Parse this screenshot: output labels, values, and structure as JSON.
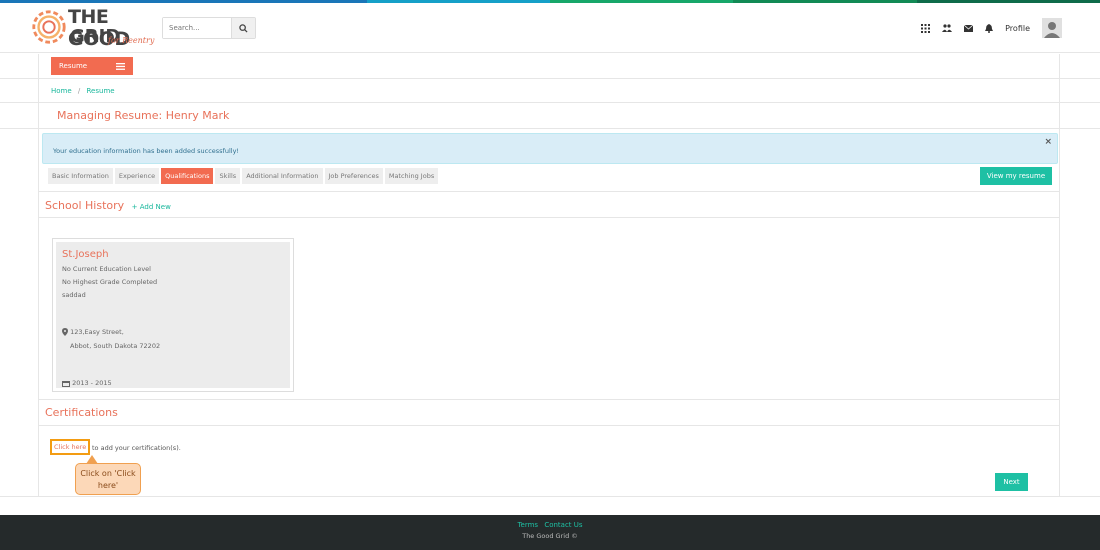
{
  "brand": {
    "word1": "THE GOOD",
    "word2": "GRID",
    "tagline": "for Reentry",
    "stripe_colors": [
      "#1a76b8",
      "#1a76b8",
      "#16a0c8",
      "#17a76a",
      "#128a55",
      "#0f6b4a"
    ]
  },
  "search": {
    "placeholder": "Search...",
    "icon": "search-icon"
  },
  "nav": {
    "icons": [
      "apps-grid-icon",
      "users-icon",
      "envelope-icon",
      "bell-icon"
    ],
    "profile_label": "Profile",
    "avatar_icon": "user-avatar-icon"
  },
  "menu": {
    "resume_label": "Resume",
    "menu_icon": "hamburger-icon"
  },
  "breadcrumb": {
    "home": "Home",
    "separator": "/",
    "current": "Resume"
  },
  "page_title": "Managing Resume: Henry Mark",
  "alert": {
    "message": "Your education information has been added successfully!",
    "close": "×"
  },
  "tabs": [
    {
      "label": "Basic Information",
      "active": false
    },
    {
      "label": "Experience",
      "active": false
    },
    {
      "label": "Qualifications",
      "active": true
    },
    {
      "label": "Skills",
      "active": false
    },
    {
      "label": "Additional Information",
      "active": false
    },
    {
      "label": "Job Preferences",
      "active": false
    },
    {
      "label": "Matching Jobs",
      "active": false
    }
  ],
  "view_resume_label": "View my resume",
  "school_history": {
    "title": "School History",
    "add_new": "+ Add New",
    "card": {
      "school": "St.Joseph",
      "education_level": "No Current Education Level",
      "highest_grade": "No Highest Grade Completed",
      "note": "saddad",
      "address_line1": "123,Easy Street,",
      "address_line2": "Abbot, South Dakota 72202",
      "dates": "2013 - 2015"
    }
  },
  "certifications": {
    "title": "Certifications",
    "link": "Click here",
    "rest": "to add your certification(s).",
    "callout": "Click on 'Click here'"
  },
  "next_label": "Next",
  "footer": {
    "terms": "Terms",
    "contact": "Contact Us",
    "copyright": "The Good Grid ©"
  },
  "colors": {
    "accent": "#f26b50",
    "teal": "#1ec0a4",
    "alert_bg": "#d9edf7",
    "footer_bg": "#252a2b"
  }
}
